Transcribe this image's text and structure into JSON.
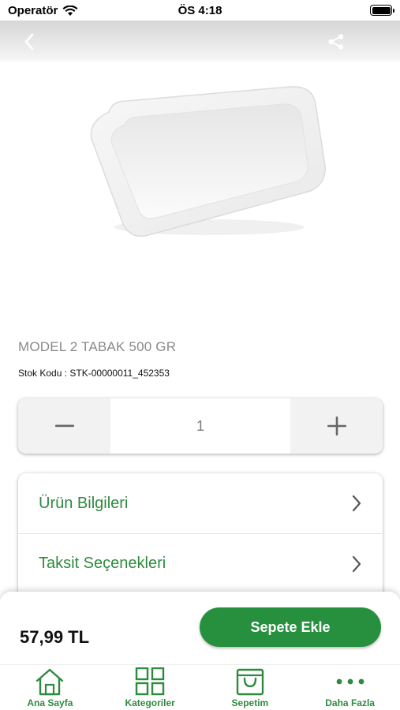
{
  "status_bar": {
    "carrier": "Operatör",
    "time": "ÖS 4:18"
  },
  "nav": {
    "back_icon": "chevron-left-icon",
    "share_icon": "share-icon"
  },
  "product": {
    "title": "MODEL 2 TABAK 500 GR",
    "stock_label": "Stok Kodu :",
    "stock_code": "STK-00000011_452353",
    "image": "white-foam-tray"
  },
  "quantity": {
    "minus_icon": "minus-icon",
    "value": "1",
    "plus_icon": "plus-icon"
  },
  "info_rows": [
    {
      "label": "Ürün Bilgileri"
    },
    {
      "label": "Taksit Seçenekleri"
    }
  ],
  "buy_bar": {
    "price": "57,99 TL",
    "add_to_cart": "Sepete Ekle"
  },
  "tabs": [
    {
      "label": "Ana Sayfa",
      "icon": "home-icon"
    },
    {
      "label": "Kategoriler",
      "icon": "grid-icon"
    },
    {
      "label": "Sepetim",
      "icon": "cart-icon"
    },
    {
      "label": "Daha Fazla",
      "icon": "more-icon"
    }
  ],
  "colors": {
    "accent": "#27903f",
    "label_green": "#2e8b3e"
  }
}
